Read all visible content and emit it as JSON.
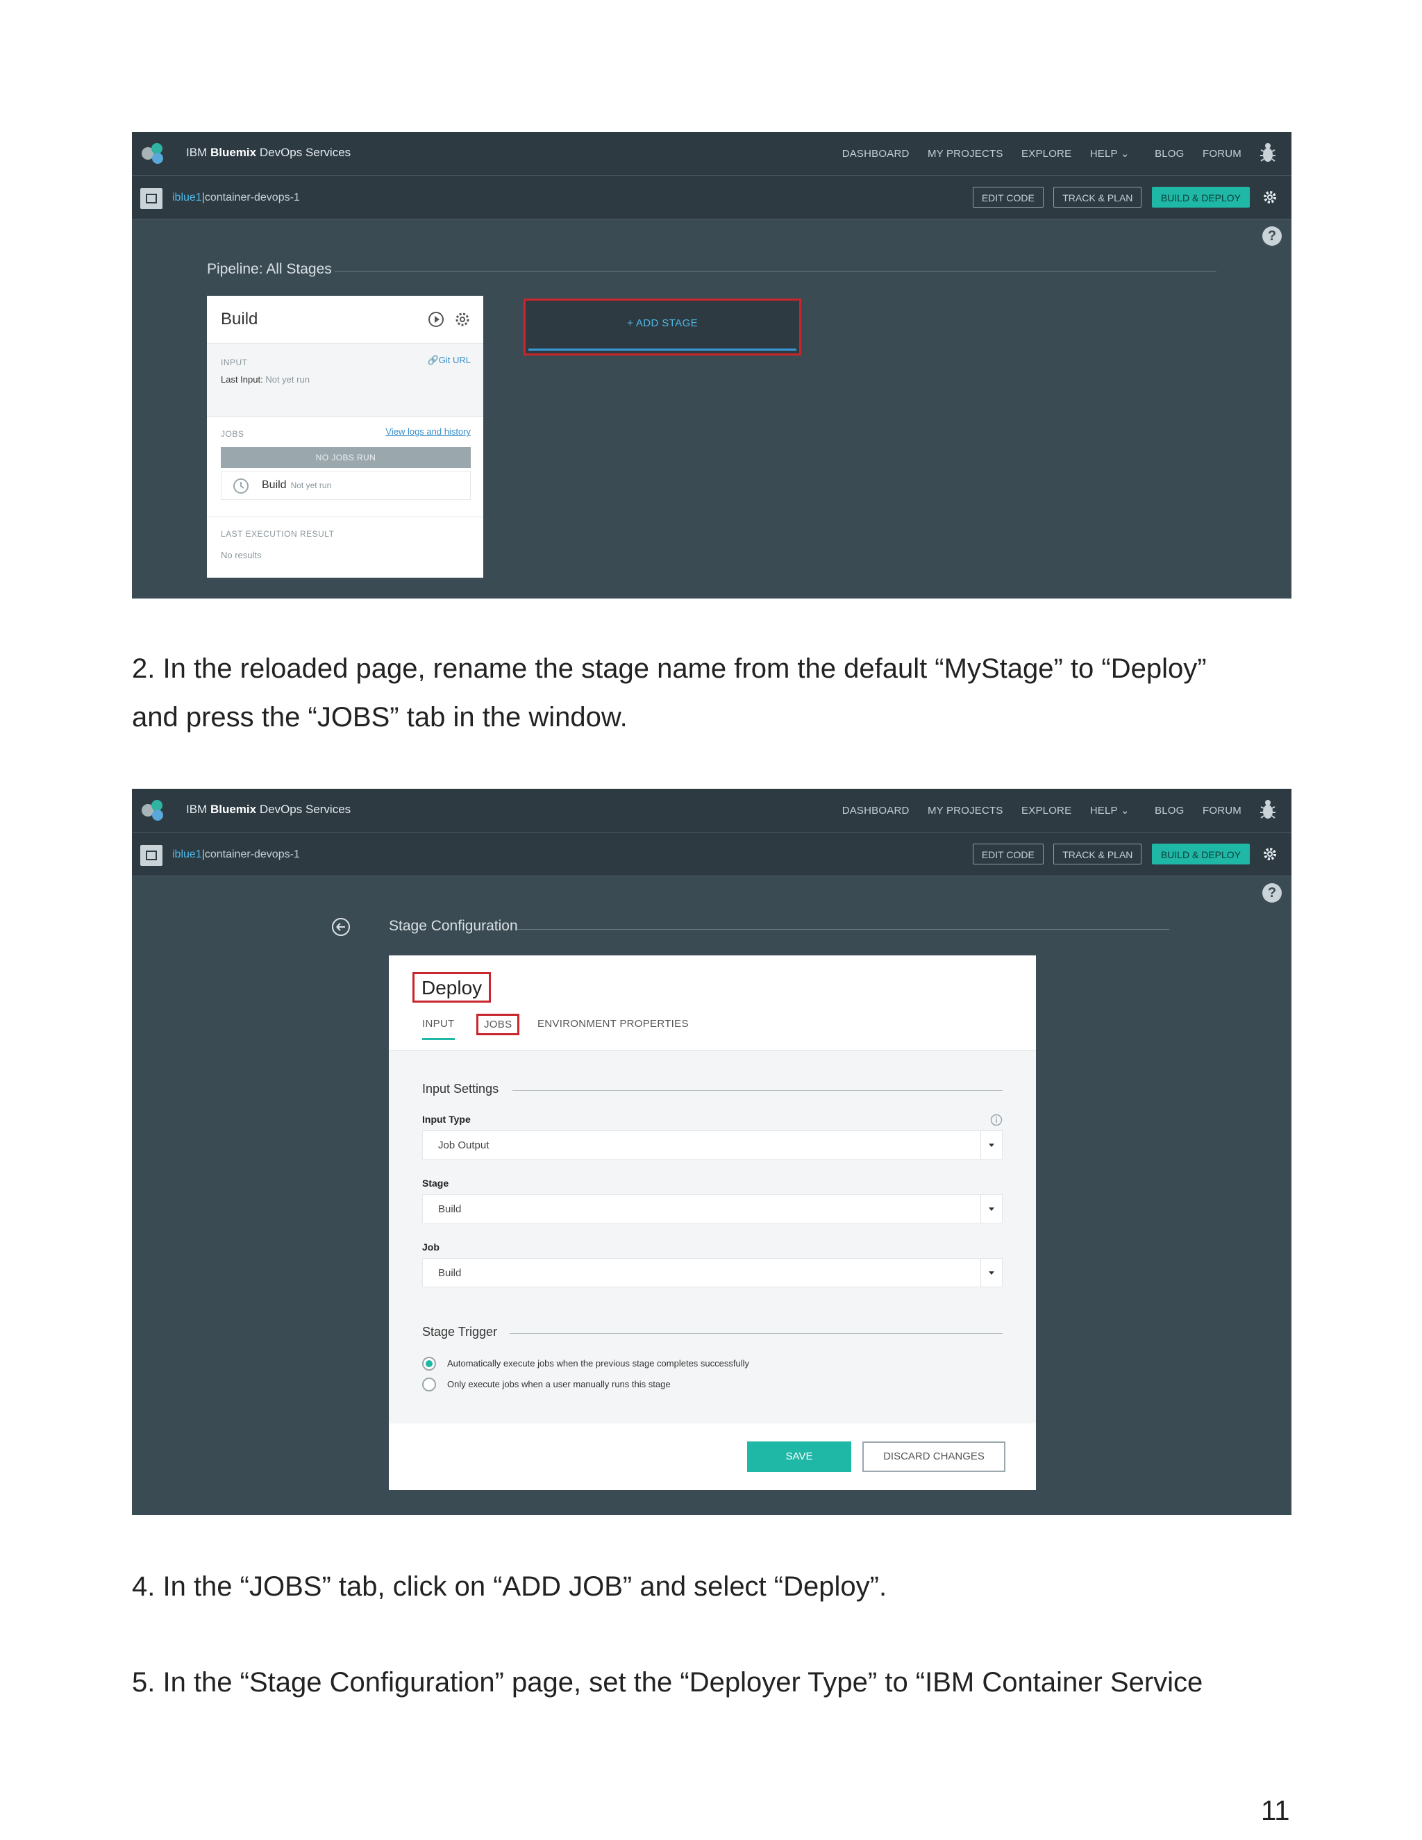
{
  "screenshot1": {
    "brand": {
      "ibm": "IBM",
      "bluemix": "Bluemix",
      "rest": "DevOps Services"
    },
    "nav": [
      "DASHBOARD",
      "MY PROJECTS",
      "EXPLORE",
      "HELP ⌄",
      "BLOG",
      "FORUM"
    ],
    "project": {
      "user": "iblue1",
      "separator": "|",
      "name": "container-devops-1"
    },
    "project_buttons": [
      "EDIT CODE",
      "TRACK & PLAN",
      "BUILD & DEPLOY"
    ],
    "help_glyph": "?",
    "pipeline_title": "Pipeline: All Stages",
    "stage_card": {
      "title": "Build",
      "input_label": "INPUT",
      "git_url": "Git URL",
      "last_input_label": "Last Input:",
      "last_input_value": "Not yet run",
      "jobs_label": "JOBS",
      "view_logs": "View logs and history",
      "no_jobs": "NO JOBS RUN",
      "job_name": "Build",
      "job_status": "Not yet run",
      "last_execution_label": "LAST EXECUTION RESULT",
      "no_results": "No results"
    },
    "add_stage": "+ ADD STAGE"
  },
  "para_step2": [
    "2. In the reloaded page, rename the stage name from the default “MyStage” to “Deploy”",
    "and press the “JOBS” tab in the window."
  ],
  "screenshot2": {
    "brand": {
      "ibm": "IBM",
      "bluemix": "Bluemix",
      "rest": "DevOps Services"
    },
    "nav": [
      "DASHBOARD",
      "MY PROJECTS",
      "EXPLORE",
      "HELP ⌄",
      "BLOG",
      "FORUM"
    ],
    "project": {
      "user": "iblue1",
      "separator": "|",
      "name": "container-devops-1"
    },
    "project_buttons": [
      "EDIT CODE",
      "TRACK & PLAN",
      "BUILD & DEPLOY"
    ],
    "help_glyph": "?",
    "config_title": "Stage Configuration",
    "stage_name": "Deploy",
    "tabs": [
      "INPUT",
      "JOBS",
      "ENVIRONMENT PROPERTIES"
    ],
    "input_settings": "Input Settings",
    "input_type_label": "Input Type",
    "input_type_value": "Job Output",
    "stage_label": "Stage",
    "stage_value": "Build",
    "job_label": "Job",
    "job_value": "Build",
    "stage_trigger": "Stage Trigger",
    "trigger_auto": "Automatically execute jobs when the previous stage completes successfully",
    "trigger_manual": "Only execute jobs when a user manually runs this stage",
    "save": "SAVE",
    "discard": "DISCARD CHANGES"
  },
  "para_step4": "4. In the “JOBS” tab, click on “ADD JOB” and select “Deploy”.",
  "para_step5": "5. In the “Stage Configuration” page, set the “Deployer Type” to “IBM Container Service",
  "page_number": "11"
}
